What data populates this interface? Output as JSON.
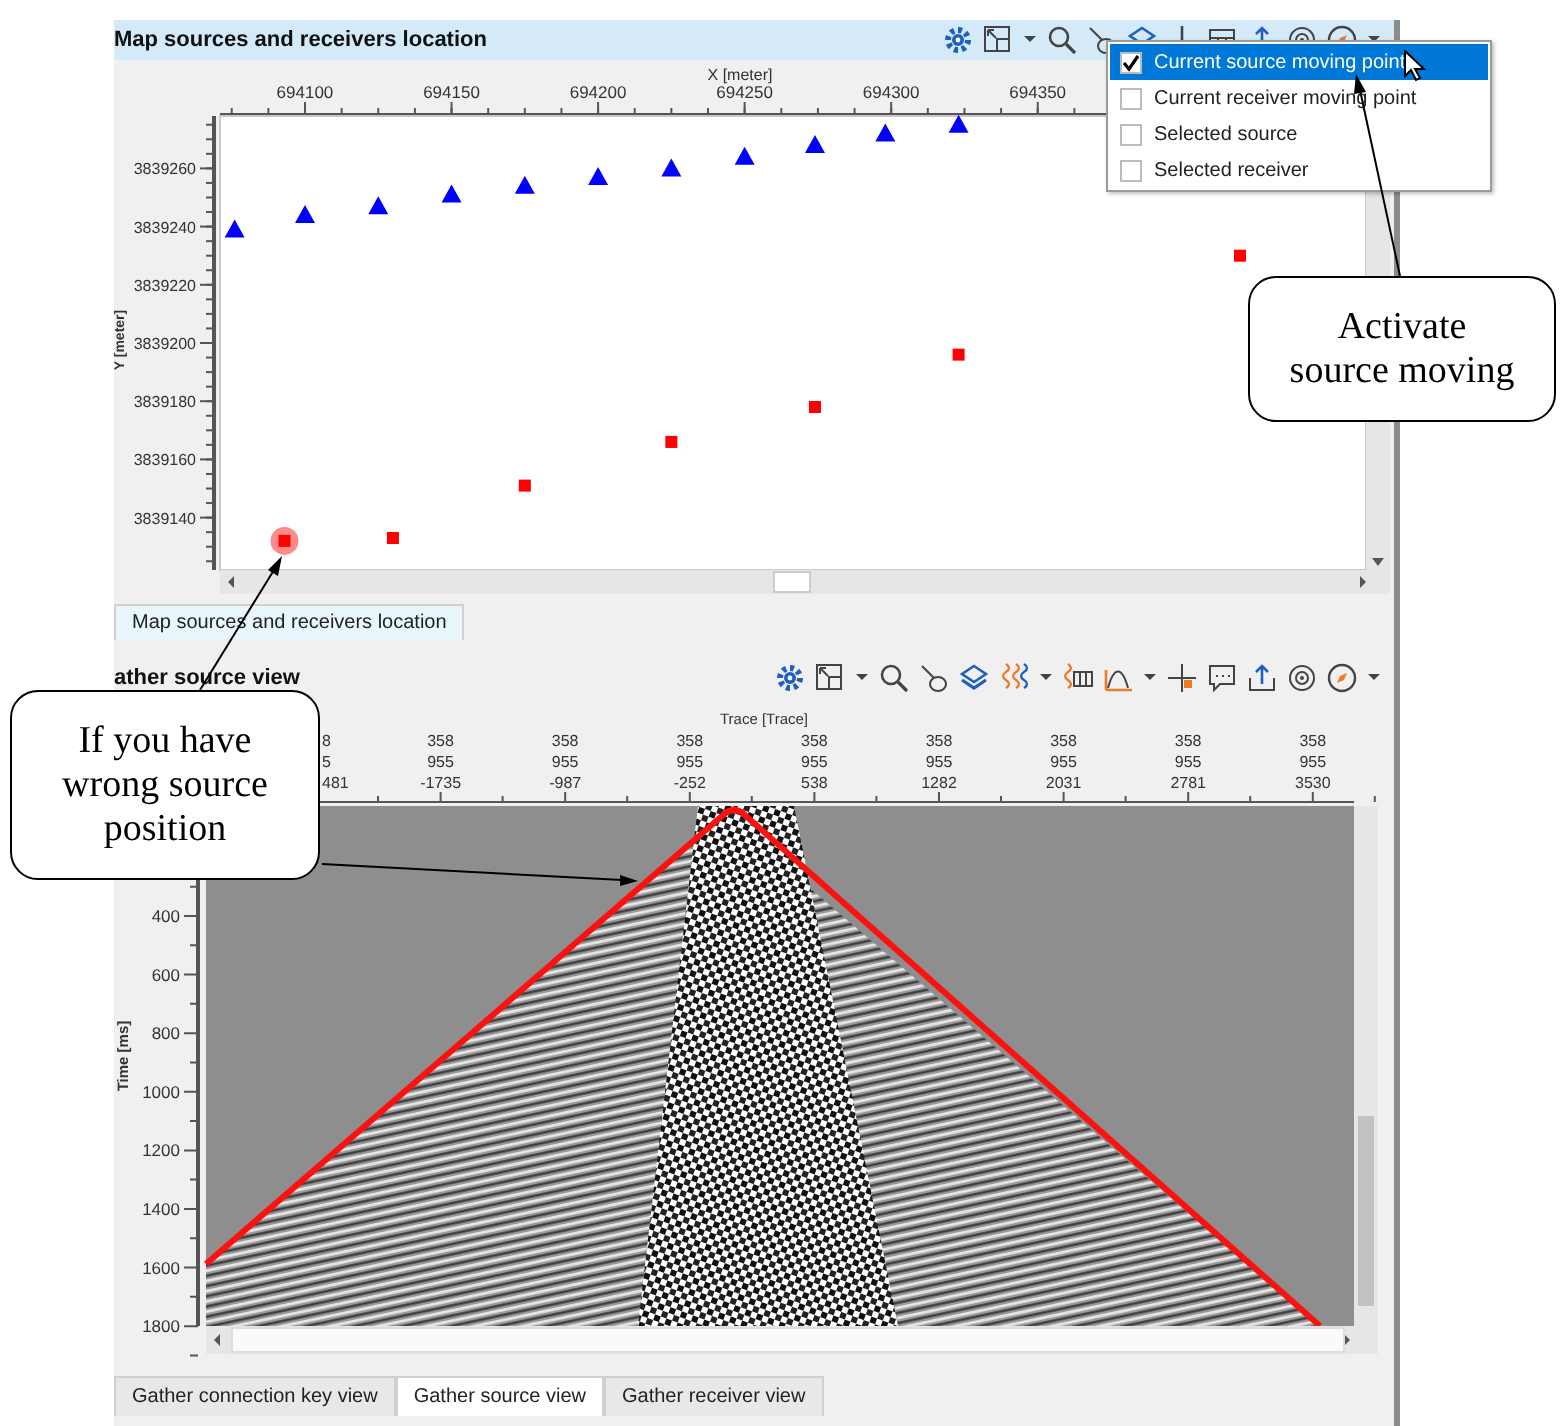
{
  "map_panel": {
    "title": "Map sources and receivers location",
    "chart_data": {
      "type": "scatter",
      "xlabel": "X [meter]",
      "ylabel": "Y [meter]",
      "xlim": [
        694071,
        694462
      ],
      "ylim": [
        3839122,
        3839278
      ],
      "xticks": [
        694100,
        694150,
        694200,
        694250,
        694300,
        694350
      ],
      "yticks": [
        3839140,
        3839160,
        3839180,
        3839200,
        3839220,
        3839240,
        3839260
      ],
      "x": [
        694076,
        694093,
        694100,
        694125,
        694130,
        694150,
        694175,
        694200,
        694225,
        694250,
        694274,
        694298,
        694323,
        694419
      ],
      "series": [
        {
          "marker": "triangle",
          "color": "#0000ff",
          "values": [
            3839239,
            null,
            3839244,
            3839247,
            null,
            3839251,
            3839254,
            3839257,
            3839260,
            3839264,
            3839268,
            3839272,
            3839275,
            null
          ]
        },
        {
          "marker": "square",
          "color": "#ff0000",
          "values": [
            null,
            3839132,
            null,
            null,
            3839133,
            null,
            3839151,
            null,
            3839166,
            null,
            3839178,
            null,
            3839196,
            3839230
          ]
        }
      ]
    },
    "tab": {
      "label": "Map sources and receivers location",
      "selected": true
    }
  },
  "overlay_menu": {
    "items": [
      {
        "label": "Current source moving point",
        "checked": true,
        "selected": true
      },
      {
        "label": "Current receiver moving point",
        "checked": false,
        "selected": false
      },
      {
        "label": "Selected source",
        "checked": false,
        "selected": false
      },
      {
        "label": "Selected receiver",
        "checked": false,
        "selected": false
      }
    ]
  },
  "gather_panel": {
    "title": "ather source view",
    "trace_axis": {
      "title": "Trace [Trace]",
      "columns": [
        {
          "line_1": "8",
          "line_2": "5",
          "line_3": "481"
        },
        {
          "line_1": "358",
          "line_2": "955",
          "line_3": "-1735"
        },
        {
          "line_1": "358",
          "line_2": "955",
          "line_3": "-987"
        },
        {
          "line_1": "358",
          "line_2": "955",
          "line_3": "-252"
        },
        {
          "line_1": "358",
          "line_2": "955",
          "line_3": "538"
        },
        {
          "line_1": "358",
          "line_2": "955",
          "line_3": "1282"
        },
        {
          "line_1": "358",
          "line_2": "955",
          "line_3": "2031"
        },
        {
          "line_1": "358",
          "line_2": "955",
          "line_3": "2781"
        },
        {
          "line_1": "358",
          "line_2": "955",
          "line_3": "3530"
        }
      ]
    },
    "time_axis": {
      "title": "Time [ms]",
      "ticks": [
        "400",
        "600",
        "800",
        "1000",
        "1200",
        "1400",
        "1600",
        "1800"
      ]
    }
  },
  "bottom_tabs": [
    {
      "label": "Gather connection key view",
      "selected": false
    },
    {
      "label": "Gather source view",
      "selected": true
    },
    {
      "label": "Gather receiver view",
      "selected": false
    }
  ],
  "callouts": [
    {
      "text": "Activate\nsource moving"
    },
    {
      "text": "If you have\nwrong source\nposition"
    }
  ]
}
